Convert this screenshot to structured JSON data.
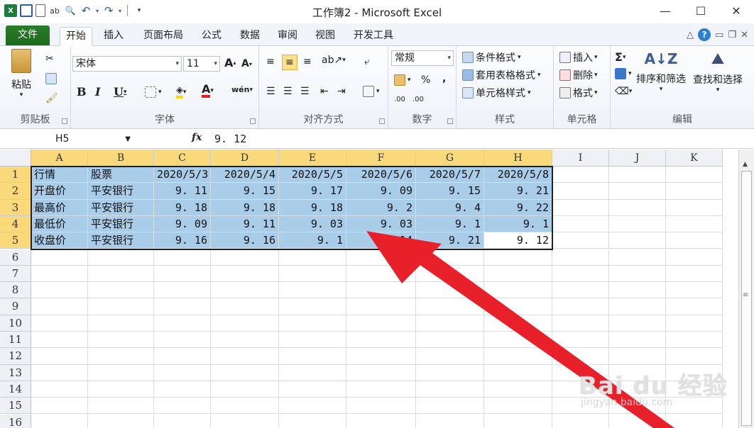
{
  "window": {
    "title": "工作簿2 - Microsoft Excel",
    "minimize": "—",
    "maximize": "☐",
    "close": "✕"
  },
  "ribbon_tabs": [
    "文件",
    "开始",
    "插入",
    "页面布局",
    "公式",
    "数据",
    "审阅",
    "视图",
    "开发工具"
  ],
  "ribbon": {
    "clipboard": {
      "paste": "粘贴",
      "label": "剪贴板"
    },
    "font": {
      "name": "宋体",
      "size": "11",
      "label": "字体",
      "bold": "B",
      "italic": "I",
      "underline": "U",
      "grow": "A",
      "shrink": "A",
      "phonetic": "wén"
    },
    "alignment": {
      "label": "对齐方式"
    },
    "number": {
      "format": "常规",
      "label": "数字",
      "percent": "%",
      "comma": ",",
      "inc": ".00",
      "dec": ".00"
    },
    "styles": {
      "conditional": "条件格式",
      "table": "套用表格格式",
      "cell": "单元格样式",
      "label": "样式"
    },
    "cells": {
      "insert": "插入",
      "delete": "删除",
      "format": "格式",
      "label": "单元格"
    },
    "editing": {
      "sum": "Σ",
      "sort": "排序和筛选",
      "find": "查找和选择",
      "label": "编辑"
    }
  },
  "formula_bar": {
    "name_box": "H5",
    "fx": "fx",
    "value": "9. 12"
  },
  "columns": [
    "A",
    "B",
    "C",
    "D",
    "E",
    "F",
    "G",
    "H",
    "I",
    "J",
    "K"
  ],
  "rows": [
    "1",
    "2",
    "3",
    "4",
    "5",
    "6",
    "7",
    "8",
    "9",
    "10",
    "11",
    "12",
    "13",
    "14",
    "15",
    "16"
  ],
  "table": [
    [
      "行情",
      "股票",
      "2020/5/3",
      "2020/5/4",
      "2020/5/5",
      "2020/5/6",
      "2020/5/7",
      "2020/5/8"
    ],
    [
      "开盘价",
      "平安银行",
      "9. 11",
      "9. 15",
      "9. 17",
      "9. 09",
      "9. 15",
      "9. 21"
    ],
    [
      "最高价",
      "平安银行",
      "9. 18",
      "9. 18",
      "9. 18",
      "9. 2",
      "9. 4",
      "9. 22"
    ],
    [
      "最低价",
      "平安银行",
      "9. 09",
      "9. 11",
      "9. 03",
      "9. 03",
      "9. 1",
      "9. 1"
    ],
    [
      "收盘价",
      "平安银行",
      "9. 16",
      "9. 16",
      "9. 1",
      "14",
      "9. 21",
      "9. 12"
    ]
  ],
  "watermark": {
    "main": "Bai du 经验",
    "sub": "jingyan.baidu.com"
  }
}
